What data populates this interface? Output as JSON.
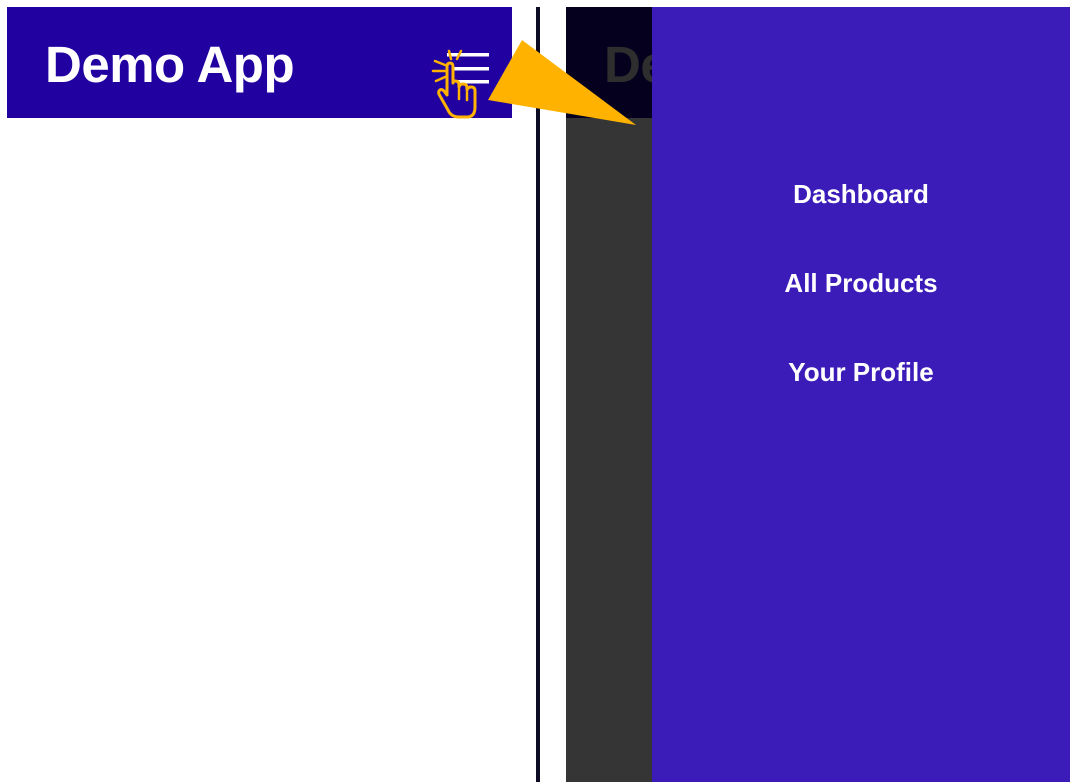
{
  "left": {
    "app_title": "Demo App",
    "menu_icon": "hamburger-menu-icon",
    "tap_icon": "hand-pointer-tap-icon"
  },
  "right": {
    "app_title_dimmed": "Demo App",
    "drawer": {
      "items": [
        {
          "label": "Dashboard"
        },
        {
          "label": "All Products"
        },
        {
          "label": "Your Profile"
        }
      ]
    }
  },
  "annotation": {
    "arrow_icon": "arrow-right-icon"
  },
  "colors": {
    "header_bg": "#2101a0",
    "drawer_bg": "#3b1cb9",
    "overlay_bg": "#353535",
    "accent_arrow": "#ffb300",
    "text_on_primary": "#ffffff"
  }
}
